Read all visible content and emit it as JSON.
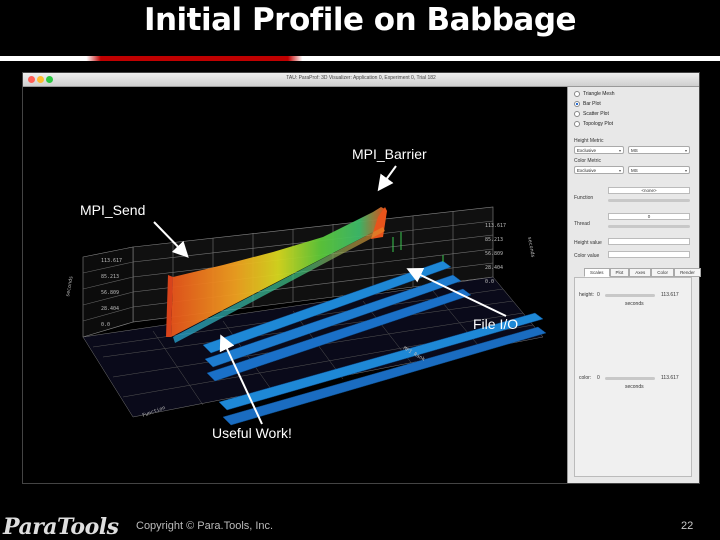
{
  "slide": {
    "title": "Initial Profile on Babbage",
    "copyright": "Copyright © Para.Tools, Inc.",
    "page_number": "22",
    "logo_text": "ParaTools",
    "title_rule_colors": [
      "#ffffff",
      "#c00000",
      "#ffffff"
    ]
  },
  "window": {
    "title": "TAU: ParaProf: 3D Visualizer: Application 0, Experiment 0, Trial 182",
    "traffic_light_colors": [
      "#ff5f57",
      "#febc2e",
      "#28c840"
    ]
  },
  "annotations": {
    "mpi_barrier": "MPI_Barrier",
    "mpi_send": "MPI_Send",
    "file_io": "File I/O",
    "useful_work": "Useful Work!"
  },
  "visualization": {
    "axis_ticks_left": [
      "113.617",
      "85.213",
      "56.809",
      "28.404",
      "0.0"
    ],
    "axis_ticks_right": [
      "113.617",
      "85.213",
      "56.809",
      "28.404",
      "0.0"
    ],
    "axis_label_left": "seconds",
    "axis_label_right": "seconds",
    "axis_label_front": "MPI Rank",
    "axis_label_depth": "Function",
    "surface_colors": [
      "#e8541b",
      "#f0a020",
      "#d8d81e",
      "#5cc83a",
      "#1ea8d6",
      "#1a5ab8"
    ]
  },
  "side_panel": {
    "plot_types": [
      {
        "label": "Triangle Mesh",
        "selected": false
      },
      {
        "label": "Bar Plot",
        "selected": true
      },
      {
        "label": "Scatter Plot",
        "selected": false
      },
      {
        "label": "Topology Plot",
        "selected": false
      }
    ],
    "height_metric_label": "Height Metric",
    "height_metric_value": "Exclusive",
    "height_metric_unit": "MS",
    "color_metric_label": "Color Metric",
    "color_metric_value": "Exclusive",
    "color_metric_unit": "MS",
    "function_label": "Function",
    "function_value": "<none>",
    "thread_label": "Thread",
    "thread_value": "0",
    "height_value_label": "Height value",
    "color_value_label": "Color value",
    "tabs": [
      "Scales",
      "Plot",
      "Axes",
      "Color",
      "Render"
    ],
    "active_tab": "Scales",
    "height_label": "height:",
    "height_min": "0",
    "height_max": "113.617",
    "height_unit": "seconds",
    "color_label": "color:",
    "color_min": "0",
    "color_max": "113.617",
    "color_unit": "seconds"
  }
}
